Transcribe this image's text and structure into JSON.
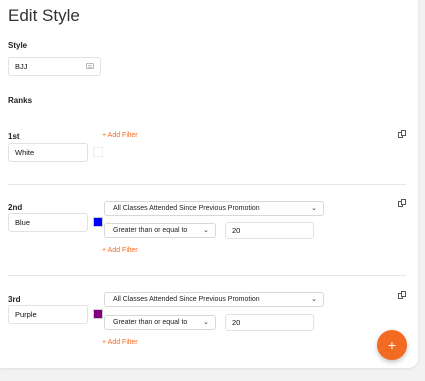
{
  "page": {
    "title": "Edit Style"
  },
  "style_section": {
    "label": "Style",
    "value": "BJJ"
  },
  "ranks_label": "Ranks",
  "add_filter_label": "+ Add Filter",
  "ranks": [
    {
      "ordinal": "1st",
      "name": "White",
      "color": "#ffffff",
      "filters": []
    },
    {
      "ordinal": "2nd",
      "name": "Blue",
      "color": "#0000ff",
      "filters": [
        {
          "criteria": "All Classes Attended Since Previous Promotion",
          "operator": "Greater than or equal to",
          "value": "20"
        }
      ]
    },
    {
      "ordinal": "3rd",
      "name": "Purple",
      "color": "#800080",
      "filters": [
        {
          "criteria": "All Classes Attended Since Previous Promotion",
          "operator": "Greater than or equal to",
          "value": "20"
        }
      ]
    }
  ],
  "fab": {
    "label": "+"
  },
  "colors": {
    "accent": "#f26b21"
  },
  "icons": {
    "copy": "copy-icon",
    "style_field": "list-icon",
    "dropdown": "chevron-down-icon",
    "add": "plus-icon"
  }
}
